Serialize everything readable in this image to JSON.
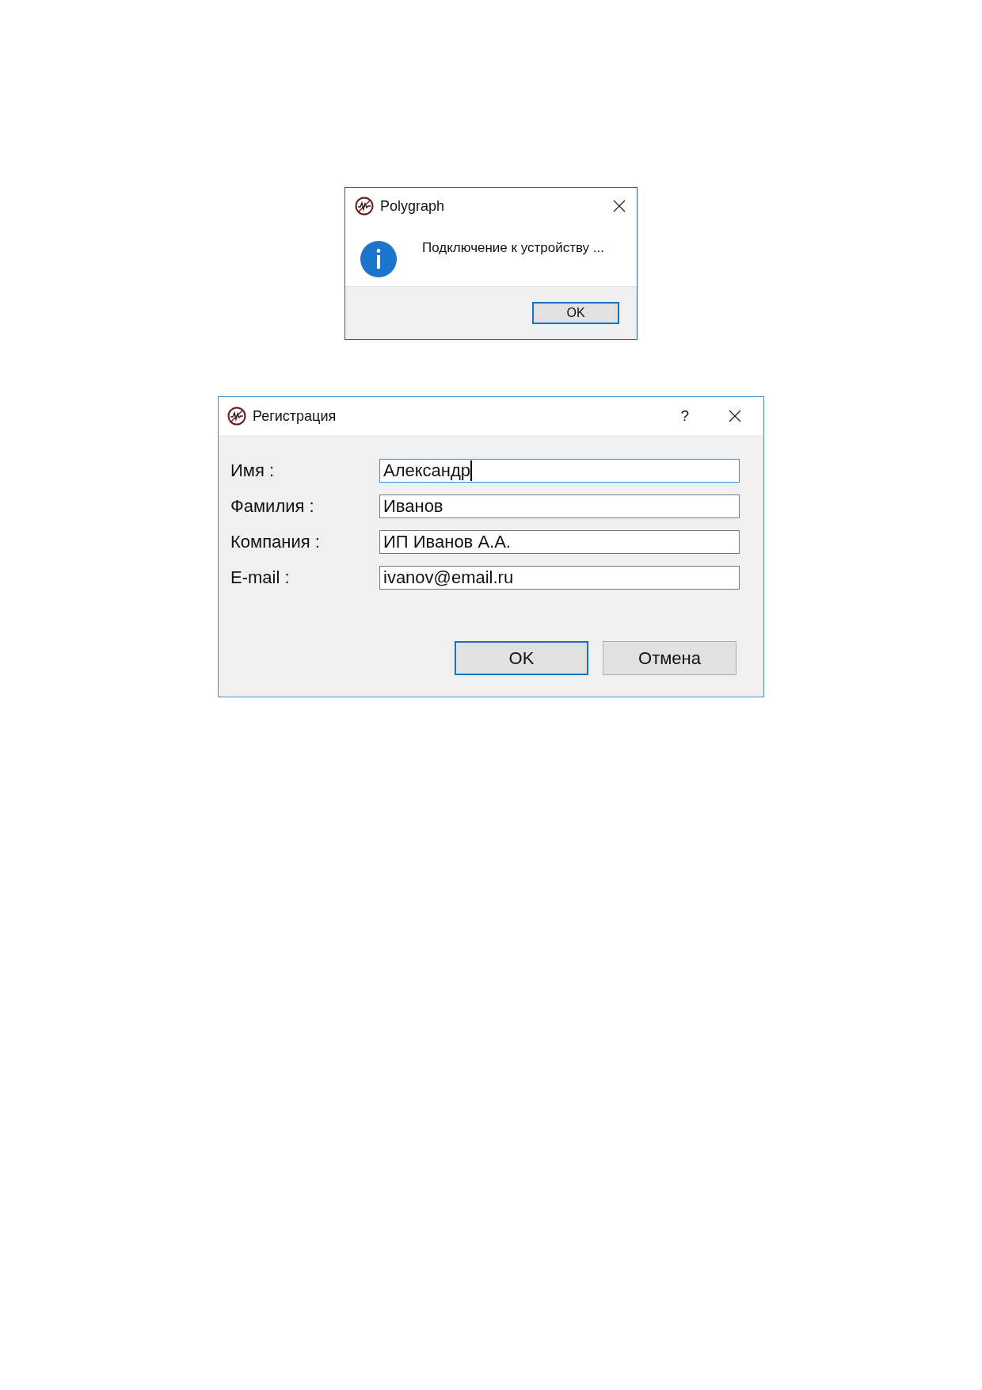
{
  "message_box": {
    "title": "Polygraph",
    "message": "Подключение к устройству ...",
    "buttons": [
      {
        "label": "OK",
        "default": true
      }
    ]
  },
  "registration_dialog": {
    "title": "Регистрация",
    "help_button": "?",
    "fields": [
      {
        "label": "Имя :",
        "value": "Александр",
        "focused": true
      },
      {
        "label": "Фамилия :",
        "value": "Иванов",
        "focused": false
      },
      {
        "label": "Компания :",
        "value": "ИП Иванов А.А.",
        "focused": false
      },
      {
        "label": "E-mail :",
        "value": "ivanov@email.ru",
        "focused": false
      }
    ],
    "buttons": [
      {
        "label": "OK",
        "default": true
      },
      {
        "label": "Отмена",
        "default": false
      }
    ]
  }
}
